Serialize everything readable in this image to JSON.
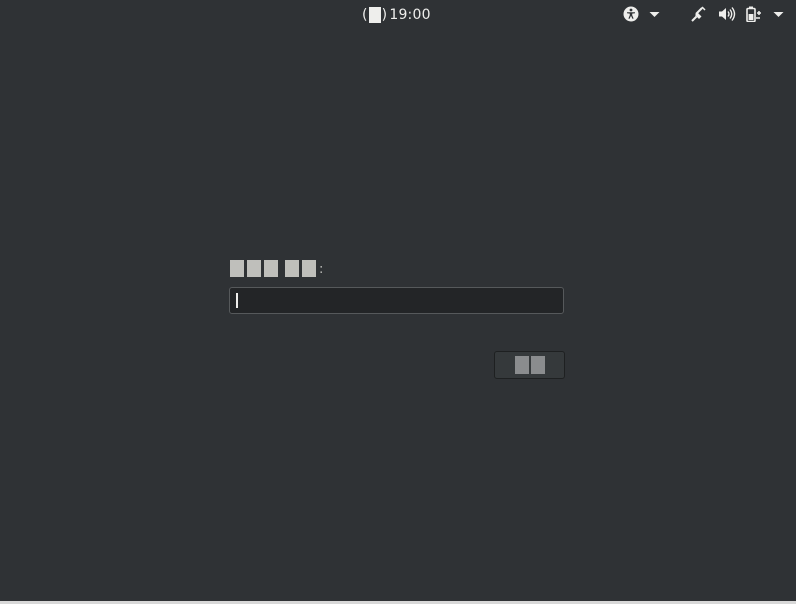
{
  "topbar": {
    "clock_prefix": "(",
    "clock_suffix": ")",
    "clock_time": "19:00",
    "icons": [
      "accessibility-icon",
      "chevron-down-icon",
      "network-wired-icon",
      "volume-icon",
      "battery-icon",
      "chevron-down-icon"
    ]
  },
  "login": {
    "prompt_label_colon": ":",
    "password_value": ""
  },
  "colors": {
    "background": "#2f3235",
    "text": "#eeeeec",
    "input_bg": "#232527",
    "button_bg": "#35393b"
  }
}
